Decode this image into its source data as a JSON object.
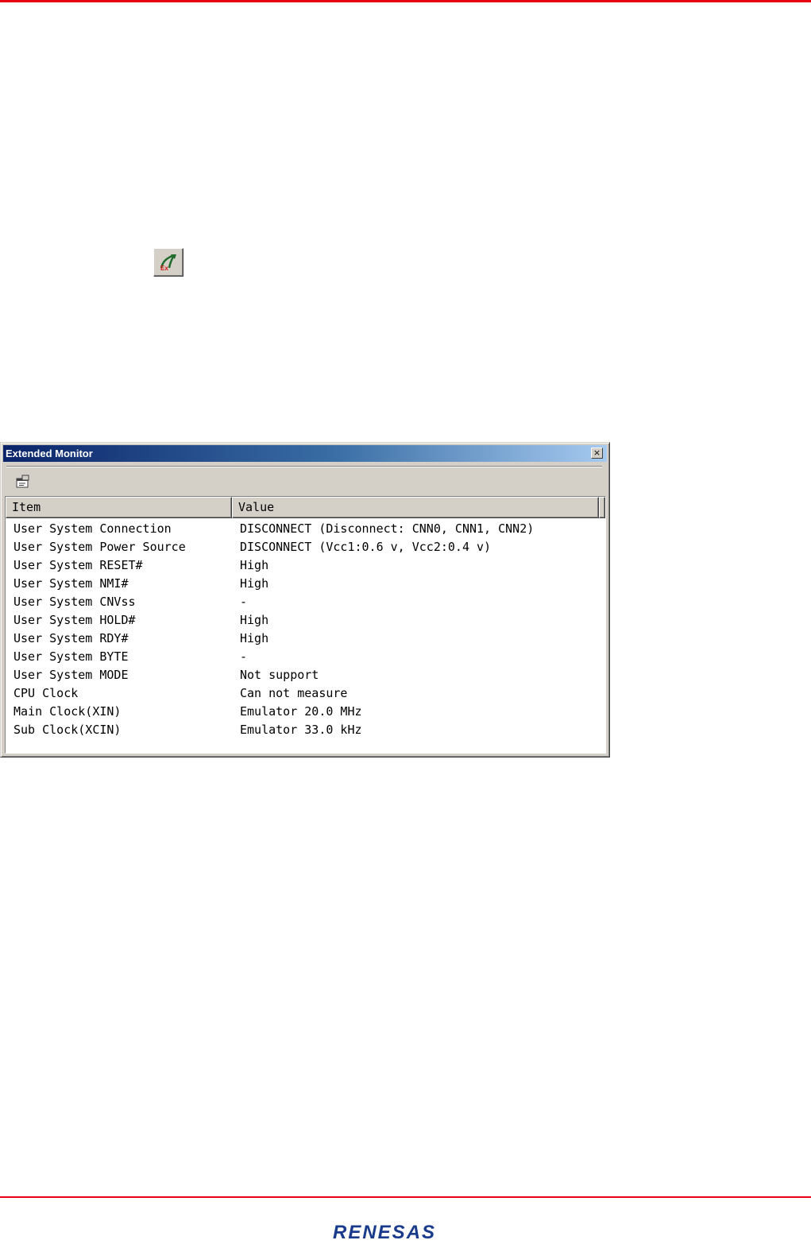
{
  "window": {
    "title": "Extended Monitor",
    "close_glyph": "×"
  },
  "listview": {
    "columns": [
      "Item",
      "Value"
    ],
    "rows": [
      {
        "item": "User System Connection",
        "value": "DISCONNECT (Disconnect: CNN0, CNN1, CNN2)"
      },
      {
        "item": "User System Power Source",
        "value": "DISCONNECT (Vcc1:0.6 v, Vcc2:0.4 v)"
      },
      {
        "item": "User System RESET#",
        "value": "High"
      },
      {
        "item": "User System NMI#",
        "value": "High"
      },
      {
        "item": "User System CNVss",
        "value": "-"
      },
      {
        "item": "User System HOLD#",
        "value": "High"
      },
      {
        "item": "User System RDY#",
        "value": "High"
      },
      {
        "item": "User System BYTE",
        "value": "-"
      },
      {
        "item": "User System MODE",
        "value": "Not support"
      },
      {
        "item": "CPU Clock",
        "value": "Can not measure"
      },
      {
        "item": "Main Clock(XIN)",
        "value": "Emulator 20.0 MHz"
      },
      {
        "item": "Sub Clock(XCIN)",
        "value": "Emulator 33.0 kHz"
      }
    ]
  },
  "footer": {
    "logo_text": "RENESAS"
  },
  "icons": {
    "toolbar_button": "extended-monitor-icon",
    "window_toolbar": "properties-icon"
  },
  "colors": {
    "brand_red": "#e60012",
    "logo_blue": "#1a3b8c",
    "titlebar_start": "#0a246a",
    "titlebar_end": "#a6caf0"
  }
}
